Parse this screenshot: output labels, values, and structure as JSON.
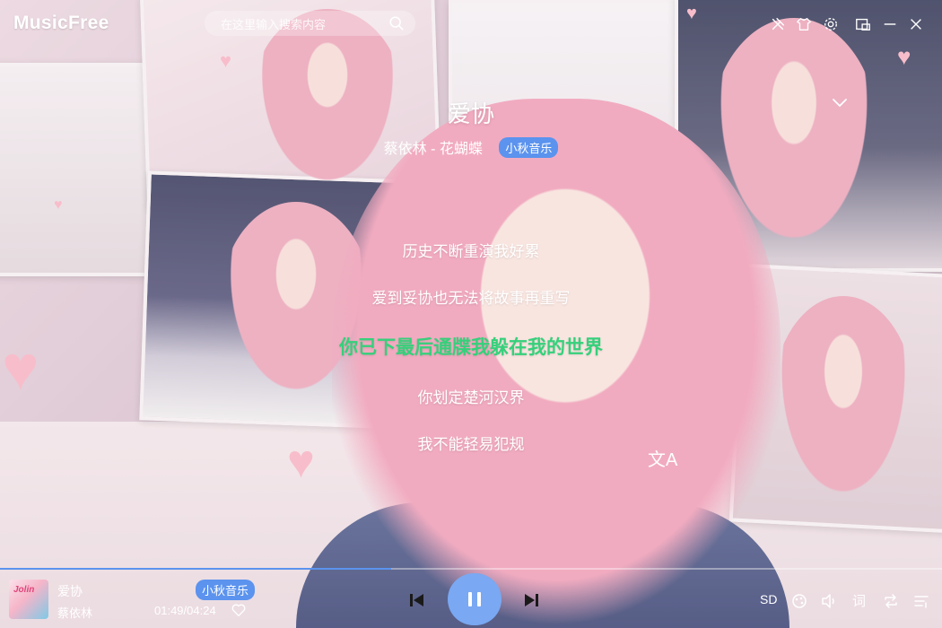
{
  "app": {
    "name": "MusicFree"
  },
  "search": {
    "placeholder": "在这里输入搜索内容"
  },
  "icons": {
    "window": [
      "pin-icon",
      "skin-icon",
      "settings-icon",
      "mini-mode-icon",
      "minimize-icon",
      "close-icon"
    ],
    "player": [
      "previous-icon",
      "pause-icon",
      "next-icon",
      "heart-icon"
    ],
    "right": [
      "sound-effect-icon",
      "volume-icon",
      "lyric-icon",
      "repeat-icon",
      "playlist-icon",
      "translate-icon",
      "chevron-down-icon"
    ]
  },
  "song": {
    "title": "爱协",
    "artist_album": "蔡依林 - 花蝴蝶",
    "source": "小秋音乐"
  },
  "lyrics": {
    "lines": [
      "历史不断重演我好累",
      "爱到妥协也无法将故事再重写",
      "你已下最后通牒我躲在我的世界",
      "你划定楚河汉界",
      "我不能轻易犯规"
    ],
    "active_index": 2,
    "translate_glyph": "文A"
  },
  "player": {
    "title": "爱协",
    "artist": "蔡依林",
    "source": "小秋音乐",
    "time": "01:49/04:24",
    "progress": 0.415,
    "quality": "SD",
    "lyric_toggle": "词",
    "cover_text": "Jolin"
  },
  "colors": {
    "accent": "#5b93ee",
    "active_lyric": "#36d07b",
    "play_button": "#7aa8f2"
  }
}
